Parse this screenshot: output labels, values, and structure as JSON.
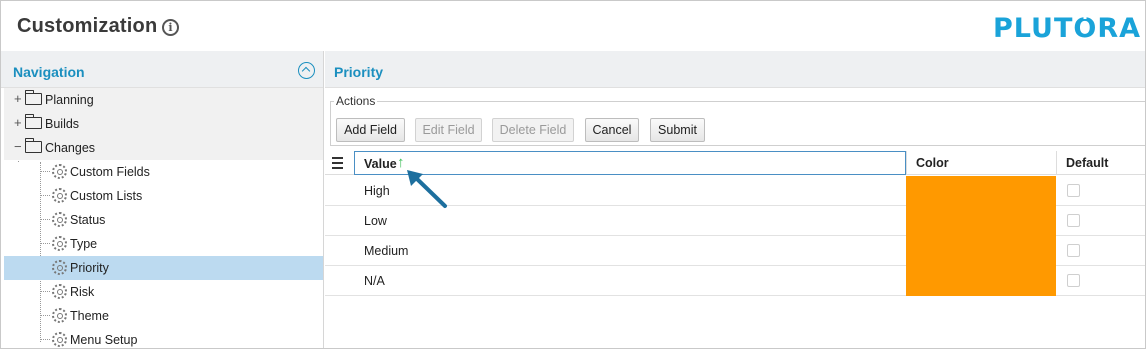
{
  "header": {
    "title": "Customization",
    "info_glyph": "i",
    "logo_text": "PLUTORA",
    "brand_color": "#1aa3d9"
  },
  "nav": {
    "title": "Navigation",
    "folders": [
      {
        "label": "Planning",
        "expanded": false
      },
      {
        "label": "Builds",
        "expanded": false
      },
      {
        "label": "Changes",
        "expanded": true
      }
    ],
    "items": [
      {
        "label": "Custom Fields"
      },
      {
        "label": "Custom Lists"
      },
      {
        "label": "Status"
      },
      {
        "label": "Type"
      },
      {
        "label": "Priority",
        "selected": true
      },
      {
        "label": "Risk"
      },
      {
        "label": "Theme"
      },
      {
        "label": "Menu Setup"
      }
    ],
    "accent_color": "#1b8fbf",
    "selected_bg": "#bcdaf0"
  },
  "main": {
    "title": "Priority",
    "actions": {
      "legend": "Actions",
      "add_label": "Add Field",
      "edit_label": "Edit Field",
      "delete_label": "Delete Field",
      "cancel_label": "Cancel",
      "submit_label": "Submit"
    },
    "grid": {
      "columns": {
        "value": "Value",
        "color": "Color",
        "default": "Default"
      },
      "sort": "ascending",
      "rows": [
        {
          "value": "High",
          "color": "#ff9900",
          "default": false
        },
        {
          "value": "Low",
          "color": "#ff9900",
          "default": false
        },
        {
          "value": "Medium",
          "color": "#ff9900",
          "default": false
        },
        {
          "value": "N/A",
          "color": "#ff9900",
          "default": false
        }
      ]
    }
  }
}
